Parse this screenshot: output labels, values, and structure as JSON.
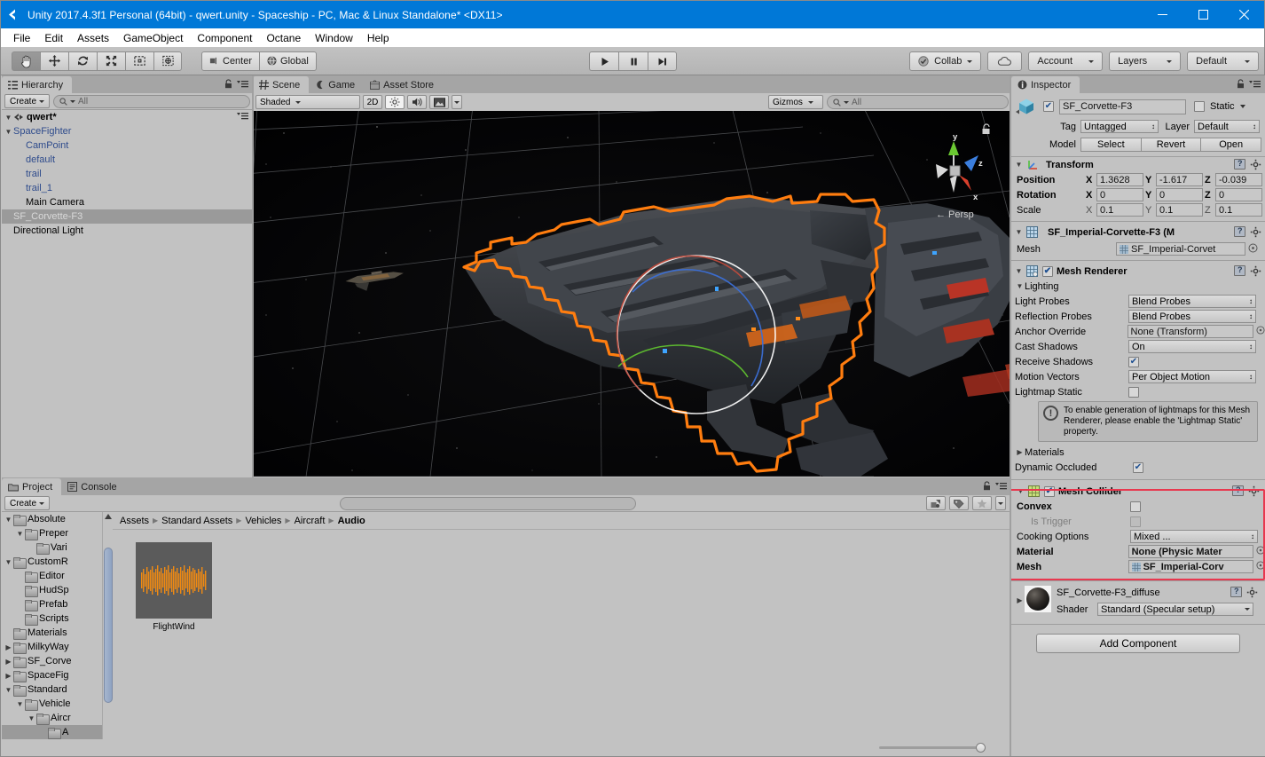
{
  "window": {
    "title": "Unity 2017.4.3f1 Personal (64bit) - qwert.unity - Spaceship - PC, Mac & Linux Standalone* <DX11>",
    "minimize": "—",
    "maximize": "□",
    "close": "✕"
  },
  "menubar": {
    "items": [
      "File",
      "Edit",
      "Assets",
      "GameObject",
      "Component",
      "Octane",
      "Window",
      "Help"
    ]
  },
  "toolbar": {
    "tools": [
      "hand-tool",
      "move-tool",
      "rotate-tool",
      "scale-tool",
      "rect-tool",
      "transform-tool"
    ],
    "active_tool_index": 0,
    "pivot_label": "Center",
    "space_label": "Global",
    "play": "▶",
    "pause": "⏸",
    "step": "⏭",
    "collab_label": "Collab",
    "cloud_label": "",
    "account_label": "Account",
    "layers_label": "Layers",
    "layout_label": "Default"
  },
  "hierarchy": {
    "tab_label": "Hierarchy",
    "create_label": "Create",
    "search_placeholder": "All",
    "scene_name": "qwert*",
    "items": [
      {
        "label": "SpaceFighter",
        "depth": 1,
        "expander": "down",
        "style": "blue"
      },
      {
        "label": "CamPoint",
        "depth": 2,
        "expander": "none",
        "style": "blue"
      },
      {
        "label": "default",
        "depth": 2,
        "expander": "none",
        "style": "blue"
      },
      {
        "label": "trail",
        "depth": 2,
        "expander": "none",
        "style": "blue"
      },
      {
        "label": "trail_1",
        "depth": 2,
        "expander": "none",
        "style": "blue"
      },
      {
        "label": "Main Camera",
        "depth": 2,
        "expander": "none",
        "style": "normal"
      },
      {
        "label": "SF_Corvette-F3",
        "depth": 1,
        "expander": "none",
        "style": "selected"
      },
      {
        "label": "Directional Light",
        "depth": 1,
        "expander": "none",
        "style": "normal"
      }
    ]
  },
  "scene": {
    "tabs": [
      {
        "label": "Scene",
        "icon": "grid-icon",
        "active": true
      },
      {
        "label": "Game",
        "icon": "gamepad-icon",
        "active": false
      },
      {
        "label": "Asset Store",
        "icon": "store-icon",
        "active": false
      }
    ],
    "draw_mode": "Shaded",
    "twod_label": "2D",
    "light_icon": "sun-icon",
    "audio_icon": "speaker-icon",
    "fx_icon": "image-icon",
    "gizmos_label": "Gizmos",
    "search_placeholder": "All",
    "axis_labels": {
      "y": "y",
      "x": "x",
      "z": "z"
    },
    "persp_label": "Persp",
    "lock_icon": "unlock-icon"
  },
  "project": {
    "tabs": [
      {
        "label": "Project",
        "icon": "folder-icon",
        "active": true
      },
      {
        "label": "Console",
        "icon": "console-icon",
        "active": false
      }
    ],
    "create_label": "Create",
    "search_placeholder": "",
    "breadcrumb": [
      "Assets",
      "Standard Assets",
      "Vehicles",
      "Aircraft",
      "Audio"
    ],
    "tree": [
      {
        "label": "Absolute",
        "depth": 1,
        "expander": "down"
      },
      {
        "label": "Preper",
        "depth": 2,
        "expander": "down"
      },
      {
        "label": "Vari",
        "depth": 3,
        "expander": "none"
      },
      {
        "label": "CustomR",
        "depth": 1,
        "expander": "down"
      },
      {
        "label": "Editor",
        "depth": 2,
        "expander": "none"
      },
      {
        "label": "HudSp",
        "depth": 2,
        "expander": "none"
      },
      {
        "label": "Prefab",
        "depth": 2,
        "expander": "none"
      },
      {
        "label": "Scripts",
        "depth": 2,
        "expander": "none"
      },
      {
        "label": "Materials",
        "depth": 1,
        "expander": "none"
      },
      {
        "label": "MilkyWay",
        "depth": 1,
        "expander": "right"
      },
      {
        "label": "SF_Corve",
        "depth": 1,
        "expander": "right"
      },
      {
        "label": "SpaceFig",
        "depth": 1,
        "expander": "right"
      },
      {
        "label": "Standard",
        "depth": 1,
        "expander": "down"
      },
      {
        "label": "Vehicle",
        "depth": 2,
        "expander": "down"
      },
      {
        "label": "Aircr",
        "depth": 3,
        "expander": "down"
      },
      {
        "label": "A",
        "depth": 4,
        "expander": "none",
        "selected": true
      }
    ],
    "assets": [
      {
        "name": "FlightWind",
        "type": "audioclip"
      }
    ],
    "filter_icons": [
      "asset-filter-icon",
      "label-filter-icon",
      "favorite-icon"
    ]
  },
  "inspector": {
    "tab_label": "Inspector",
    "object": {
      "name": "SF_Corvette-F3",
      "enabled": true,
      "static_label": "Static",
      "static_checked": false,
      "tag_label": "Tag",
      "tag_value": "Untagged",
      "layer_label": "Layer",
      "layer_value": "Default",
      "model_label": "Model",
      "model_buttons": [
        "Select",
        "Revert",
        "Open"
      ]
    },
    "transform": {
      "title": "Transform",
      "rows": [
        {
          "label": "Position",
          "x": "1.3628",
          "y": "-1.617",
          "z": "-0.039"
        },
        {
          "label": "Rotation",
          "x": "0",
          "y": "0",
          "z": "0"
        },
        {
          "label": "Scale",
          "x": "0.1",
          "y": "0.1",
          "z": "0.1"
        }
      ]
    },
    "mesh_filter": {
      "title": "SF_Imperial-Corvette-F3 (M",
      "mesh_label": "Mesh",
      "mesh_value": "SF_Imperial-Corvet"
    },
    "mesh_renderer": {
      "title": "Mesh Renderer",
      "enabled": true,
      "lighting_label": "Lighting",
      "fields": [
        {
          "label": "Light Probes",
          "value": "Blend Probes",
          "kind": "popup"
        },
        {
          "label": "Reflection Probes",
          "value": "Blend Probes",
          "kind": "popup"
        },
        {
          "label": "Anchor Override",
          "value": "None (Transform)",
          "kind": "object"
        },
        {
          "label": "Cast Shadows",
          "value": "On",
          "kind": "popup"
        },
        {
          "label": "Receive Shadows",
          "value": "",
          "kind": "checkbox",
          "checked": true
        },
        {
          "label": "Motion Vectors",
          "value": "Per Object Motion",
          "kind": "popup"
        },
        {
          "label": "Lightmap Static",
          "value": "",
          "kind": "checkbox",
          "checked": false
        }
      ],
      "help_text": "To enable generation of lightmaps for this Mesh Renderer, please enable the 'Lightmap Static' property.",
      "materials_label": "Materials",
      "dynamic_occluded_label": "Dynamic Occluded",
      "dynamic_occluded_checked": true
    },
    "mesh_collider": {
      "title": "Mesh Collider",
      "enabled": true,
      "highlighted": true,
      "highlight_color": "#e8384f",
      "fields": [
        {
          "label": "Convex",
          "value": "",
          "kind": "checkbox",
          "checked": false,
          "bold": true
        },
        {
          "label": "Is Trigger",
          "value": "",
          "kind": "checkbox",
          "checked": false,
          "disabled": true
        },
        {
          "label": "Cooking Options",
          "value": "Mixed ...",
          "kind": "popup"
        },
        {
          "label": "Material",
          "value": "None (Physic Mater",
          "kind": "object",
          "bold": true
        },
        {
          "label": "Mesh",
          "value": "SF_Imperial-Corv",
          "kind": "object",
          "bold": true
        }
      ]
    },
    "material": {
      "name": "SF_Corvette-F3_diffuse",
      "shader_label": "Shader",
      "shader_value": "Standard (Specular setup)"
    },
    "add_component_label": "Add Component"
  }
}
